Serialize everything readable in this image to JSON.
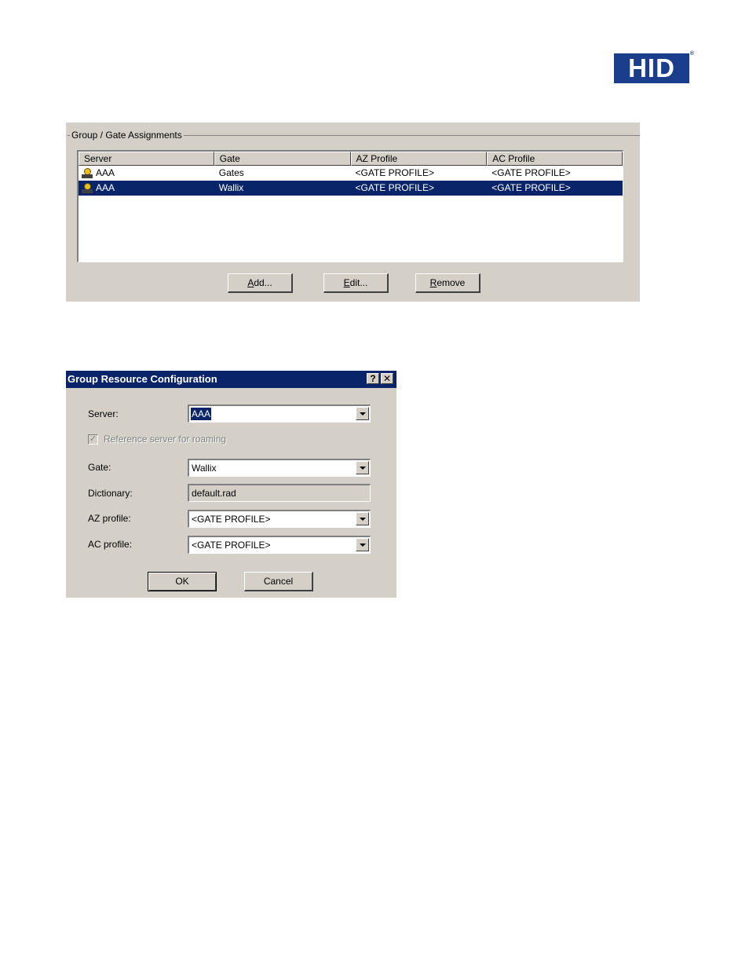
{
  "logo": {
    "text": "HID",
    "reg": "®"
  },
  "assignments": {
    "group_label": "Group / Gate Assignments",
    "columns": [
      "Server",
      "Gate",
      "AZ Profile",
      "AC Profile"
    ],
    "rows": [
      {
        "server": "AAA",
        "gate": "Gates",
        "az": "<GATE PROFILE>",
        "ac": "<GATE PROFILE>",
        "selected": false
      },
      {
        "server": "AAA",
        "gate": "Wallix",
        "az": "<GATE PROFILE>",
        "ac": "<GATE PROFILE>",
        "selected": true
      }
    ],
    "buttons": {
      "add": "dd...",
      "add_mnemonic": "A",
      "edit": "dit...",
      "edit_mnemonic": "E",
      "remove": "emove",
      "remove_mnemonic": "R"
    }
  },
  "dialog": {
    "title": "Group Resource Configuration",
    "help_glyph": "?",
    "close_glyph": "✕",
    "server_label": "Server:",
    "server_value": "AAA",
    "checkbox_label": "Reference server for roaming",
    "checkbox_glyph": "✓",
    "gate_label": "Gate:",
    "gate_value": "Wallix",
    "dictionary_label": "Dictionary:",
    "dictionary_value": "default.rad",
    "az_label": "AZ profile:",
    "az_value": "<GATE PROFILE>",
    "ac_label": "AC profile:",
    "ac_value": "<GATE PROFILE>",
    "ok": "OK",
    "cancel": "Cancel"
  }
}
